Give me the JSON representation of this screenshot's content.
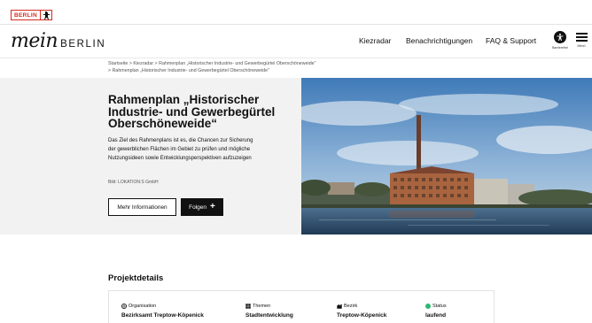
{
  "brand": {
    "tag_text": "BERLIN",
    "logo_script": "mein",
    "logo_word": "BERLIN"
  },
  "nav": {
    "items": [
      "Kiezradar",
      "Benachrichtigungen",
      "FAQ & Support"
    ],
    "accessibility_label": "Barrierefrei",
    "menu_label": "Menü"
  },
  "breadcrumb": {
    "line1": "Startseite > Kiezradar > Rahmenplan „Historischer Industrie- und Gewerbegürtel Oberschöneweide\"",
    "line2": "> Rahmenplan „Historischer Industrie- und Gewerbegürtel Oberschöneweide\""
  },
  "hero": {
    "title": "Rahmenplan „Historischer Industrie- und Gewerbegürtel Oberschöneweide“",
    "description": "Das Ziel des Rahmenplans ist es, die Chancen zur Sicherung der gewerblichen Flächen im Gebiet zu prüfen und mögliche Nutzungsideen sowie Entwicklungsperspektiven aufzuzeigen",
    "image_credit": "Bild: LOKATION:S GmbH",
    "more_label": "Mehr Informationen",
    "follow_label": "Folgen",
    "image_icon": "riverside-industrial-photo"
  },
  "project_details": {
    "title": "Projektdetails",
    "items": [
      {
        "label": "Organisation",
        "value": "Bezirksamt Treptow-Köpenick",
        "icon": "globe-icon"
      },
      {
        "label": "Themen",
        "value": "Stadtentwicklung",
        "icon": "grid-icon"
      },
      {
        "label": "Bezirk",
        "value": "Treptow-Köpenick",
        "icon": "district-icon"
      },
      {
        "label": "Status",
        "value": "laufend",
        "icon": "status-dot-icon"
      }
    ],
    "status_color": "#2eb872"
  }
}
